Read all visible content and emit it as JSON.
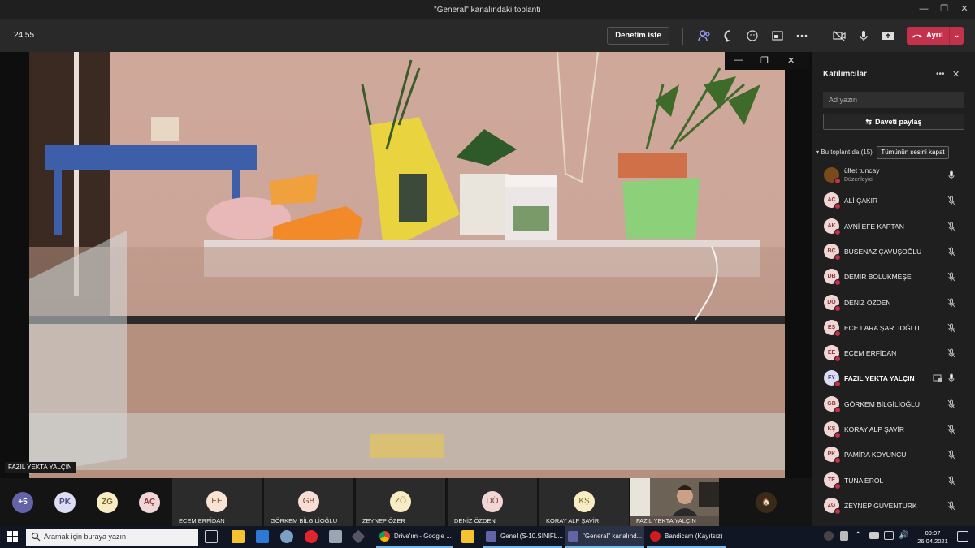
{
  "window": {
    "title": "\"General\" kanalındaki toplantı"
  },
  "toolbar": {
    "timer": "24:55",
    "record_label": "Denetim iste",
    "leave_label": "Ayrıl"
  },
  "video": {
    "speaker_name": "FAZIL YEKTA YALÇIN"
  },
  "panel": {
    "title": "Katılımcılar",
    "search_placeholder": "Ad yazın",
    "invite_label": "Daveti paylaş",
    "section_label": "Bu toplantıda (15)",
    "mute_all_label": "Tümünün sesini kapat",
    "participants": [
      {
        "initials": "",
        "name": "ülfet tuncay",
        "role": "Düzenleyici"
      },
      {
        "initials": "AÇ",
        "name": "ALİ ÇAKIR"
      },
      {
        "initials": "AK",
        "name": "AVNİ EFE KAPTAN"
      },
      {
        "initials": "BÇ",
        "name": "BUSENAZ ÇAVUŞOĞLU"
      },
      {
        "initials": "DB",
        "name": "DEMİR BÖLÜKMEŞE"
      },
      {
        "initials": "DÖ",
        "name": "DENİZ ÖZDEN"
      },
      {
        "initials": "EŞ",
        "name": "ECE LARA ŞARLIOĞLU"
      },
      {
        "initials": "EE",
        "name": "ECEM ERFİDAN"
      },
      {
        "initials": "FY",
        "name": "FAZIL YEKTA YALÇIN"
      },
      {
        "initials": "GB",
        "name": "GÖRKEM BİLGİLİOĞLU"
      },
      {
        "initials": "KŞ",
        "name": "KORAY ALP ŞAVİR"
      },
      {
        "initials": "PK",
        "name": "PAMİRA KOYUNCU"
      },
      {
        "initials": "TE",
        "name": "TUNA EROL"
      },
      {
        "initials": "ZG",
        "name": "ZEYNEP GÜVENTÜRK"
      }
    ]
  },
  "strip": {
    "overflow": "+5",
    "small": [
      "PK",
      "ZG",
      "AÇ"
    ],
    "tiles": [
      {
        "initials": "EE",
        "name": "ECEM ERFİDAN"
      },
      {
        "initials": "GB",
        "name": "GÖRKEM BİLGİLİOĞLU"
      },
      {
        "initials": "ZÖ",
        "name": "ZEYNEP ÖZER"
      },
      {
        "initials": "DÖ",
        "name": "DENİZ ÖZDEN"
      },
      {
        "initials": "KŞ",
        "name": "KORAY ALP ŞAVİR"
      }
    ],
    "cam_name": "FAZIL YEKTA YALÇIN"
  },
  "taskbar": {
    "search_placeholder": "Aramak için buraya yazın",
    "apps": [
      "Drive'ım - Google ...",
      "Genel (S-10.SINIFL...",
      "\"General\" kanalınd...",
      "Bandicam (Kayıtsız)"
    ],
    "time": "09:07",
    "date": "26.04.2021"
  }
}
